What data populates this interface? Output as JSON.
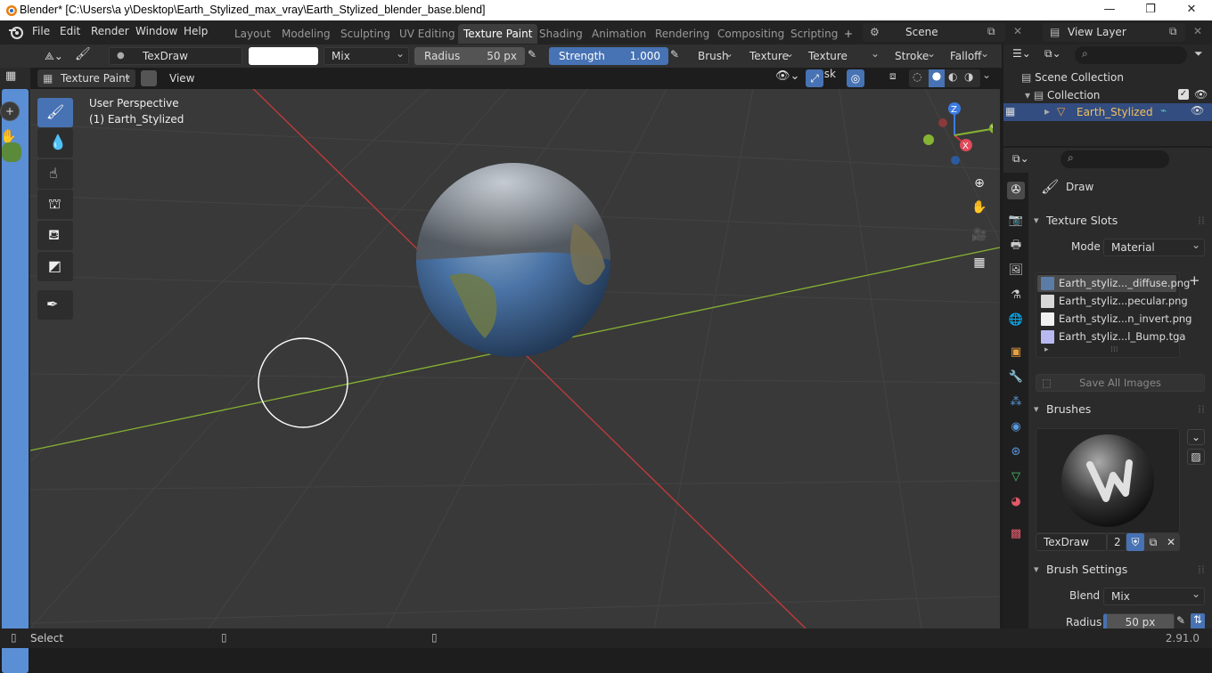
{
  "window": {
    "title": "Blender* [C:\\Users\\a y\\Desktop\\Earth_Stylized_max_vray\\Earth_Stylized_blender_base.blend]"
  },
  "menu": {
    "items": [
      "File",
      "Edit",
      "Render",
      "Window",
      "Help"
    ]
  },
  "workspaces": {
    "tabs": [
      "Layout",
      "Modeling",
      "Sculpting",
      "UV Editing",
      "Texture Paint",
      "Shading",
      "Animation",
      "Rendering",
      "Compositing",
      "Scripting"
    ],
    "active": "Texture Paint",
    "add": "+"
  },
  "scene": {
    "name": "Scene",
    "view_layer": "View Layer"
  },
  "tool_header": {
    "brush_name": "TexDraw",
    "blend_mode": "Mix",
    "radius_label": "Radius",
    "radius_value": "50 px",
    "strength_label": "Strength",
    "strength_value": "1.000",
    "strength_fraction": 1.0,
    "menus": [
      "Brush",
      "Texture",
      "Texture Mask",
      "Stroke",
      "Falloff"
    ]
  },
  "viewport_header": {
    "mode": "Texture Paint",
    "view": "View"
  },
  "viewport": {
    "perspective": "User Perspective",
    "object": "(1) Earth_Stylized"
  },
  "gizmo": {
    "x": "X",
    "y": "Y",
    "z": "Z"
  },
  "outliner": {
    "scene_collection": "Scene Collection",
    "collection": "Collection",
    "object": "Earth_Stylized"
  },
  "properties": {
    "tool_name": "Draw",
    "texture_slots": {
      "title": "Texture Slots",
      "mode_label": "Mode",
      "mode_value": "Material",
      "slots": [
        {
          "name": "Earth_styliz..._diffuse.png",
          "color": "#5b7ca6"
        },
        {
          "name": "Earth_styliz...pecular.png",
          "color": "#d8d8d8"
        },
        {
          "name": "Earth_styliz...n_invert.png",
          "color": "#f0f0f0"
        },
        {
          "name": "Earth_styliz...l_Bump.tga",
          "color": "#b9b9f2"
        }
      ],
      "save_all": "Save All Images"
    },
    "brushes": {
      "title": "Brushes",
      "brush_name": "TexDraw",
      "user_count": "2"
    },
    "brush_settings": {
      "title": "Brush Settings",
      "blend_label": "Blend",
      "blend_value": "Mix",
      "radius_label": "Radius",
      "radius_value": "50 px"
    }
  },
  "status": {
    "left": "Select",
    "version": "2.91.0"
  },
  "colors": {
    "accent": "#4772b3",
    "x_axis": "#c83a3a",
    "y_axis": "#86b332",
    "z_axis": "#3b7be0"
  }
}
